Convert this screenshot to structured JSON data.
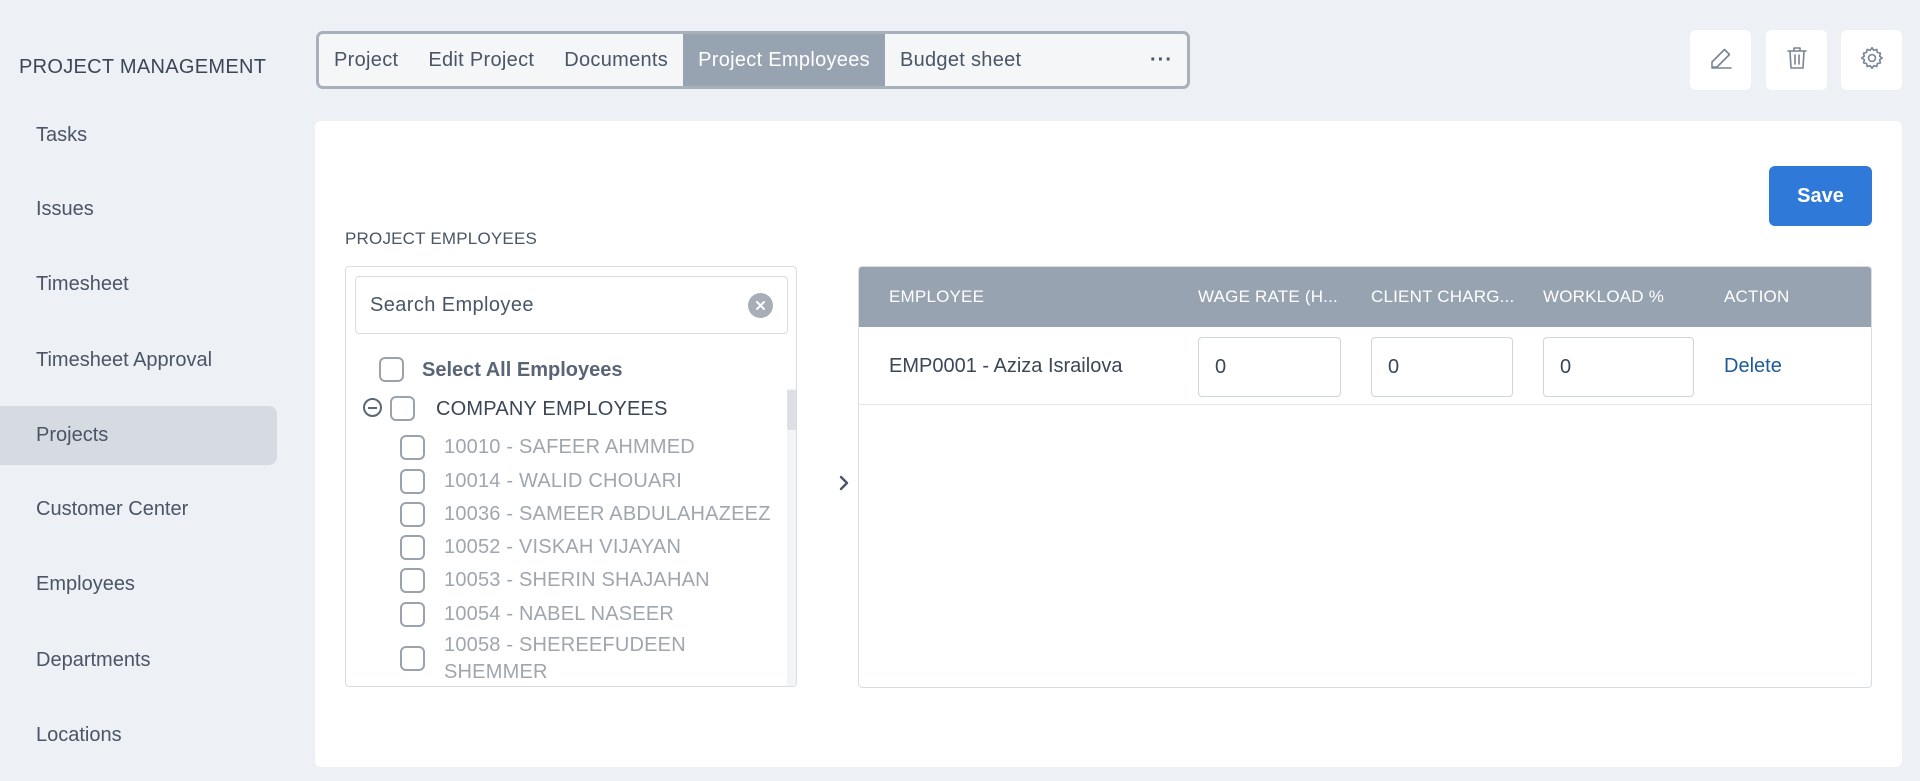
{
  "sidebar": {
    "title": "PROJECT MANAGEMENT",
    "items": [
      {
        "label": "Tasks"
      },
      {
        "label": "Issues"
      },
      {
        "label": "Timesheet"
      },
      {
        "label": "Timesheet Approval"
      },
      {
        "label": "Projects",
        "active": true
      },
      {
        "label": "Customer Center"
      },
      {
        "label": "Employees"
      },
      {
        "label": "Departments"
      },
      {
        "label": "Locations"
      }
    ]
  },
  "tabs": {
    "items": [
      {
        "label": "Project"
      },
      {
        "label": "Edit Project"
      },
      {
        "label": "Documents"
      },
      {
        "label": "Project Employees",
        "active": true
      },
      {
        "label": "Budget sheet"
      }
    ],
    "more_label": "···"
  },
  "toolbar": {
    "icons": [
      "edit-icon",
      "trash-icon",
      "gear-icon"
    ]
  },
  "main": {
    "save_label": "Save",
    "section_label": "PROJECT EMPLOYEES"
  },
  "picker": {
    "search_placeholder": "Search Employee",
    "select_all_label": "Select All Employees",
    "group_label": "COMPANY EMPLOYEES",
    "employees": [
      {
        "label": "10010 - SAFEER AHMMED"
      },
      {
        "label": "10014 - WALID CHOUARI"
      },
      {
        "label": "10036 - SAMEER ABDULAHAZEEZ"
      },
      {
        "label": "10052 - VISKAH VIJAYAN"
      },
      {
        "label": "10053 - SHERIN SHAJAHAN"
      },
      {
        "label": "10054 - NABEL NASEER"
      },
      {
        "label": "10058 - SHEREEFUDEEN",
        "label_line2": "SHEMMER"
      }
    ]
  },
  "table": {
    "columns": [
      "EMPLOYEE",
      "WAGE RATE (H...",
      "CLIENT CHARG...",
      "WORKLOAD %",
      "ACTION"
    ],
    "rows": [
      {
        "employee": "EMP0001 - Aziza Israilova",
        "wage_rate": "0",
        "client_charge": "0",
        "workload": "0",
        "action": "Delete"
      }
    ]
  },
  "colors": {
    "accent": "#2f7ad8",
    "header_bg": "#98a3b2",
    "link": "#1e5a99",
    "page_bg": "#edf0f4"
  }
}
